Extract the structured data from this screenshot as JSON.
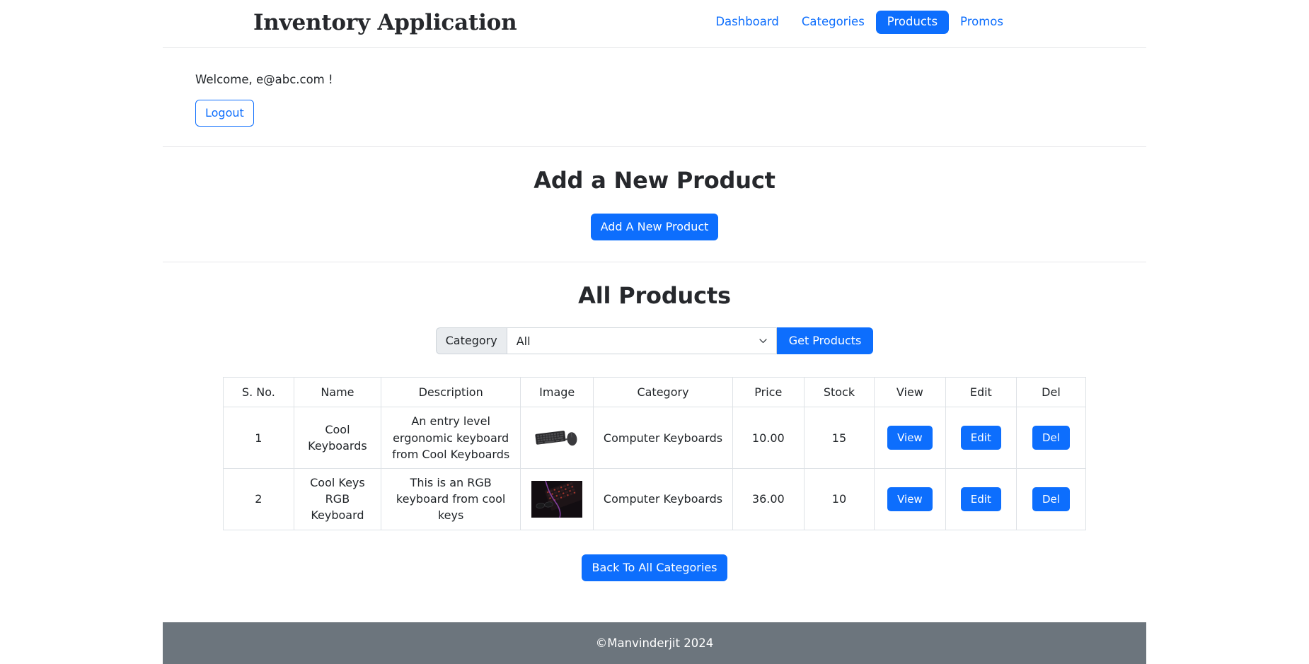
{
  "header": {
    "brand": "Inventory Application",
    "nav": [
      {
        "label": "Dashboard",
        "active": false
      },
      {
        "label": "Categories",
        "active": false
      },
      {
        "label": "Products",
        "active": true
      },
      {
        "label": "Promos",
        "active": false
      }
    ]
  },
  "account": {
    "welcome": "Welcome, e@abc.com !",
    "logout_label": "Logout"
  },
  "add_product": {
    "title": "Add a New Product",
    "button_label": "Add A New Product"
  },
  "products_section": {
    "title": "All Products",
    "filter": {
      "label": "Category",
      "selected": "All",
      "options": [
        "All"
      ],
      "submit_label": "Get Products"
    },
    "table": {
      "columns": [
        "S. No.",
        "Name",
        "Description",
        "Image",
        "Category",
        "Price",
        "Stock",
        "View",
        "Edit",
        "Del"
      ],
      "rows": [
        {
          "sno": "1",
          "name": "Cool Keyboards",
          "description": "An entry level ergonomic keyboard from Cool Keyboards",
          "image_alt": "black-keyboard-and-mouse-thumbnail",
          "category": "Computer Keyboards",
          "price": "10.00",
          "stock": "15",
          "view_label": "View",
          "edit_label": "Edit",
          "del_label": "Del"
        },
        {
          "sno": "2",
          "name": "Cool Keys RGB Keyboard",
          "description": "This is an RGB keyboard from cool keys",
          "image_alt": "rgb-backlit-keyboard-thumbnail",
          "category": "Computer Keyboards",
          "price": "36.00",
          "stock": "10",
          "view_label": "View",
          "edit_label": "Edit",
          "del_label": "Del"
        }
      ]
    },
    "back_button_label": "Back To All Categories"
  },
  "footer": {
    "copyright": "©Manvinderjit 2024"
  },
  "colors": {
    "primary": "#0d6efd",
    "footer_bg": "#6c757d",
    "border": "#dee2e6",
    "input_group_bg": "#e9ecef"
  }
}
